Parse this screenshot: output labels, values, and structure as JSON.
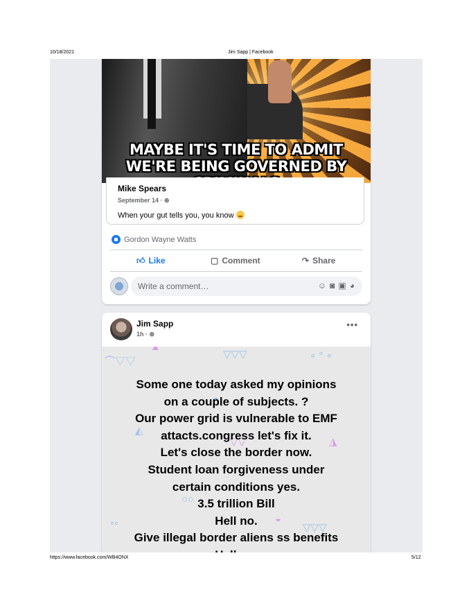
{
  "print_header": {
    "date": "10/18/2021",
    "title": "Jim Sapp | Facebook"
  },
  "print_footer": {
    "url": "https://www.facebook.com/WB4ONX",
    "page": "5/12"
  },
  "post1": {
    "meme_caption_line1": "MAYBE IT'S TIME TO ADMIT",
    "meme_caption_line2": "WE'RE BEING GOVERNED BY CRIMINALS",
    "shared": {
      "author": "Mike Spears",
      "date": "September 14 · ",
      "message": "When your gut tells you, you know"
    },
    "reactions_names": "Gordon Wayne Watts",
    "actions": {
      "like": "Like",
      "comment": "Comment",
      "share": "Share"
    },
    "comment_placeholder": "Write a comment…"
  },
  "post2": {
    "author": "Jim Sapp",
    "time": "1h · ",
    "body_lines": [
      "Some one today asked my opinions",
      "on a couple of subjects. ?",
      "Our power grid is vulnerable to EMF",
      "attacts.congress let's fix it.",
      "Let's close the border now.",
      "Student loan forgiveness under",
      "certain conditions yes.",
      "3.5 trillion Bill",
      "Hell no.",
      "Give illegal border aliens ss benefits",
      "Hell no."
    ]
  },
  "colors": {
    "facebook_blue": "#1877f2",
    "feed_bg": "#e9ebee",
    "muted_text": "#65676b"
  },
  "icons": [
    "globe-icon",
    "like-reaction-icon",
    "thumbs-up-icon",
    "comment-icon",
    "share-icon",
    "emoji-icon",
    "camera-icon",
    "gif-icon",
    "sticker-icon",
    "more-options-icon"
  ]
}
